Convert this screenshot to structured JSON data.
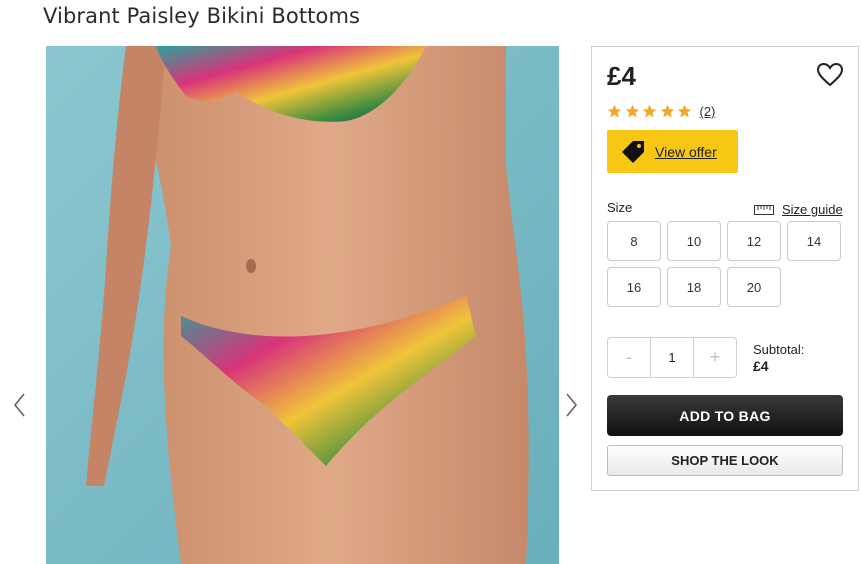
{
  "product": {
    "title": "Vibrant Paisley Bikini Bottoms",
    "price": "£4",
    "rating": 5,
    "review_count": "(2)"
  },
  "offer": {
    "label": "View offer",
    "color": "#f7c713"
  },
  "size": {
    "label": "Size",
    "guide_label": "Size guide",
    "options": [
      "8",
      "10",
      "12",
      "14",
      "16",
      "18",
      "20"
    ]
  },
  "quantity": {
    "decrement": "-",
    "value": "1",
    "increment": "+"
  },
  "subtotal": {
    "label": "Subtotal:",
    "value": "£4"
  },
  "buttons": {
    "add_to_bag": "ADD TO BAG",
    "shop_the_look": "SHOP THE LOOK"
  },
  "icons": {
    "prev": "chevron-left-icon",
    "next": "chevron-right-icon",
    "wishlist": "heart-icon",
    "offer": "price-tag-icon",
    "size_guide": "ruler-icon",
    "rating": "star-icon"
  },
  "colors": {
    "star": "#f5a623",
    "offer_bg": "#f7c713",
    "primary_button": "#1a1a1a"
  }
}
